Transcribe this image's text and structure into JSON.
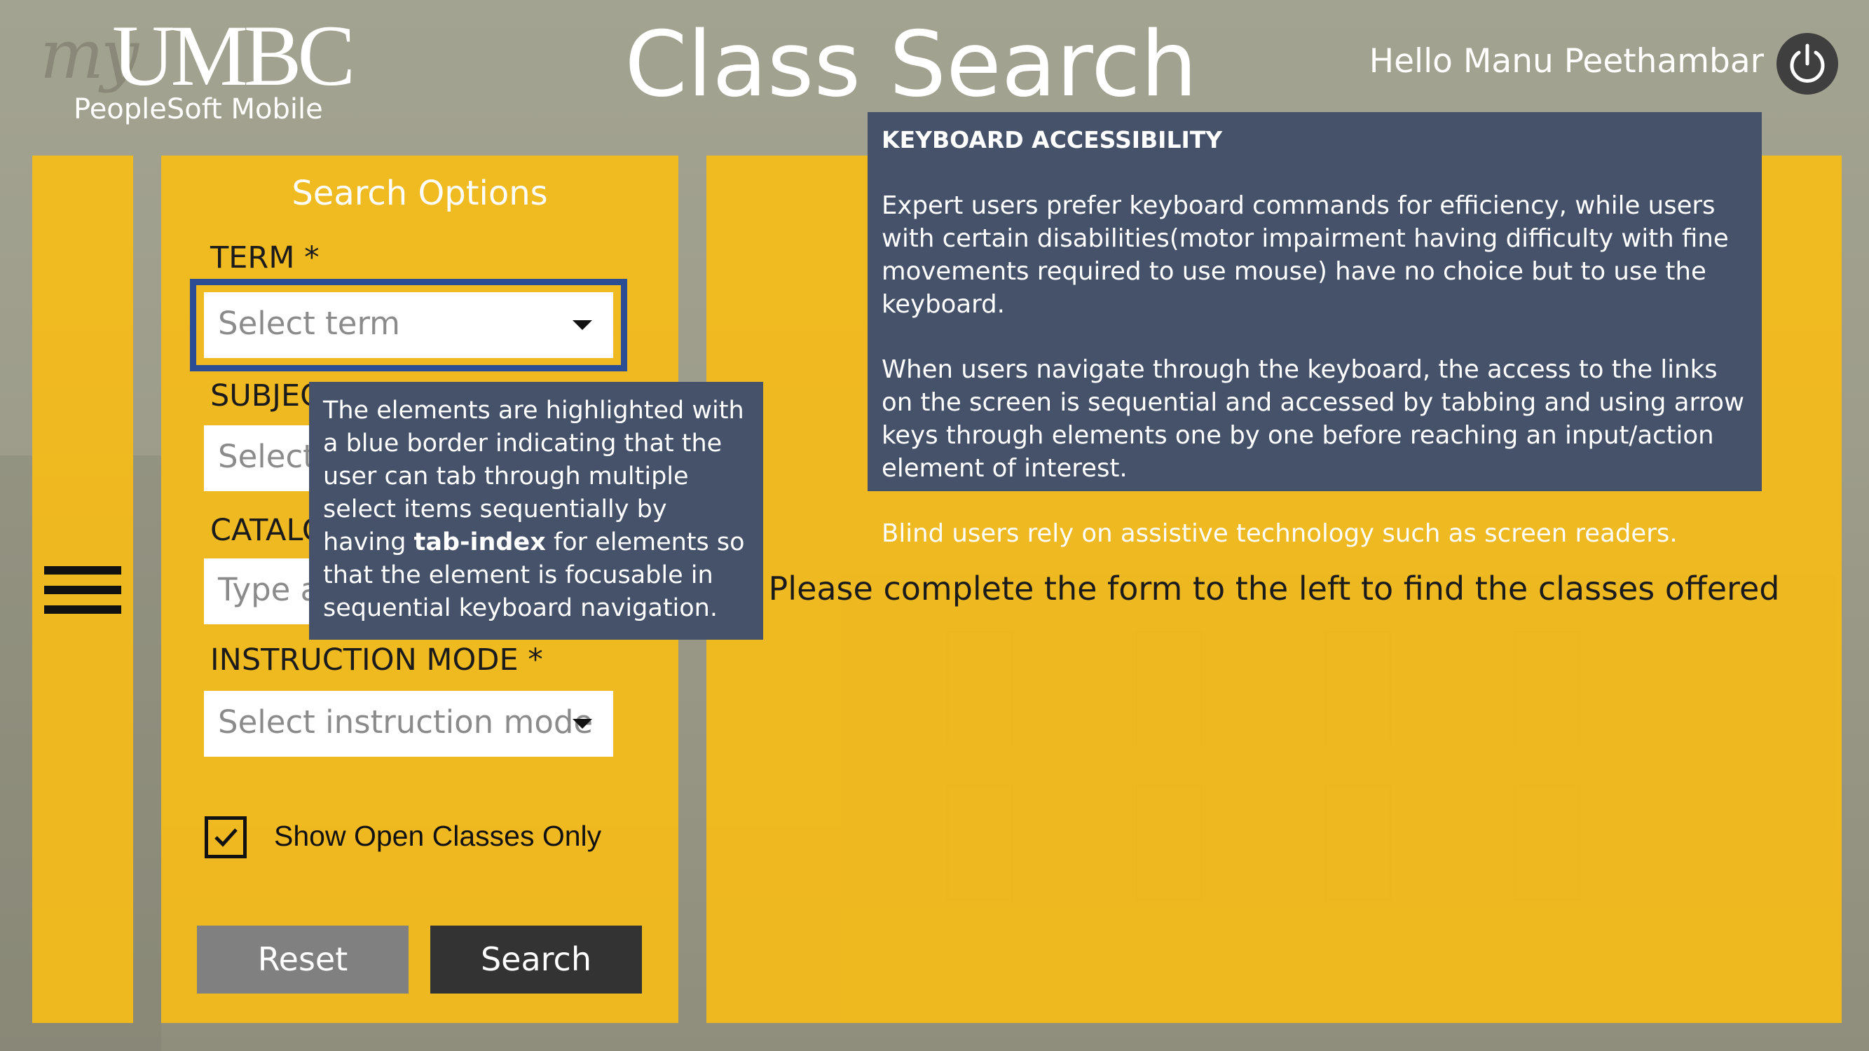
{
  "header": {
    "logo_my": "my",
    "logo_umbc": "UMBC",
    "logo_sub": "PeopleSoft Mobile",
    "title": "Class Search",
    "greeting": "Hello Manu Peethambar",
    "power_icon": "power-icon"
  },
  "search": {
    "heading": "Search Options",
    "term_label": "TERM *",
    "term_placeholder": "Select term",
    "subject_label": "SUBJEC",
    "subject_placeholder": "Select",
    "catalog_label": "CATALO",
    "catalog_placeholder": "Type a",
    "mode_label": "INSTRUCTION MODE *",
    "mode_placeholder": "Select instruction mode",
    "open_only_label": "Show Open Classes Only",
    "open_only_checked": true,
    "reset_label": "Reset",
    "search_label": "Search"
  },
  "results": {
    "message": "Please complete the form to the left to find the classes offered"
  },
  "notes": {
    "keyboard": {
      "title": "KEYBOARD ACCESSIBILITY",
      "p1": "Expert users prefer keyboard commands for efficiency, while users with certain disabilities(motor impairment having difficulty with fine movements required to use mouse) have no choice but to use the keyboard.",
      "p2": "When users navigate through the keyboard, the access to the links on the screen is sequential and accessed by tabbing and using arrow keys through elements one by one before reaching an input/action element of interest.",
      "p3": "Blind users rely on assistive technology such as screen readers."
    },
    "tab_index": {
      "before": "The elements are highlighted with a blue border indicating that the user can tab through multiple select items sequentially by having ",
      "bold": "tab-index",
      "after": " for elements so that the element is focusable in sequential keyboard navigation."
    }
  },
  "colors": {
    "panel": "#f6bc18",
    "focus_ring": "#2a4d93",
    "note_bg": "#46526a",
    "reset_bg": "#808080",
    "search_bg": "#333333"
  }
}
